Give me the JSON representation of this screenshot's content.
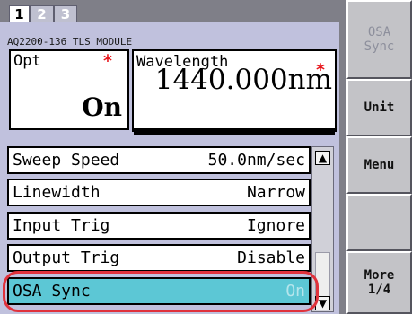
{
  "tabs": [
    "1",
    "2",
    "3"
  ],
  "module_title": "AQ2200-136 TLS MODULE",
  "opt": {
    "label": "Opt",
    "value": "On",
    "mark": "*"
  },
  "wavelength": {
    "label": "Wavelength",
    "value": "1440.000nm",
    "mark": "*"
  },
  "params": [
    {
      "label": "Sweep Speed",
      "value": "50.0nm/sec"
    },
    {
      "label": "Linewidth",
      "value": "Narrow"
    },
    {
      "label": "Input Trig",
      "value": "Ignore"
    },
    {
      "label": "Output Trig",
      "value": "Disable"
    },
    {
      "label": "OSA Sync",
      "value": "On"
    }
  ],
  "scrollbar": {
    "up": "▲",
    "down": "▼"
  },
  "softkeys": {
    "osa_sync": "OSA\nSync",
    "unit": "Unit",
    "menu": "Menu",
    "more": "More\n1/4"
  },
  "colors": {
    "panel": "#c0c1dd",
    "selected_row": "#5cc7d5",
    "marker": "#e8151b",
    "highlight": "#e0323c"
  }
}
